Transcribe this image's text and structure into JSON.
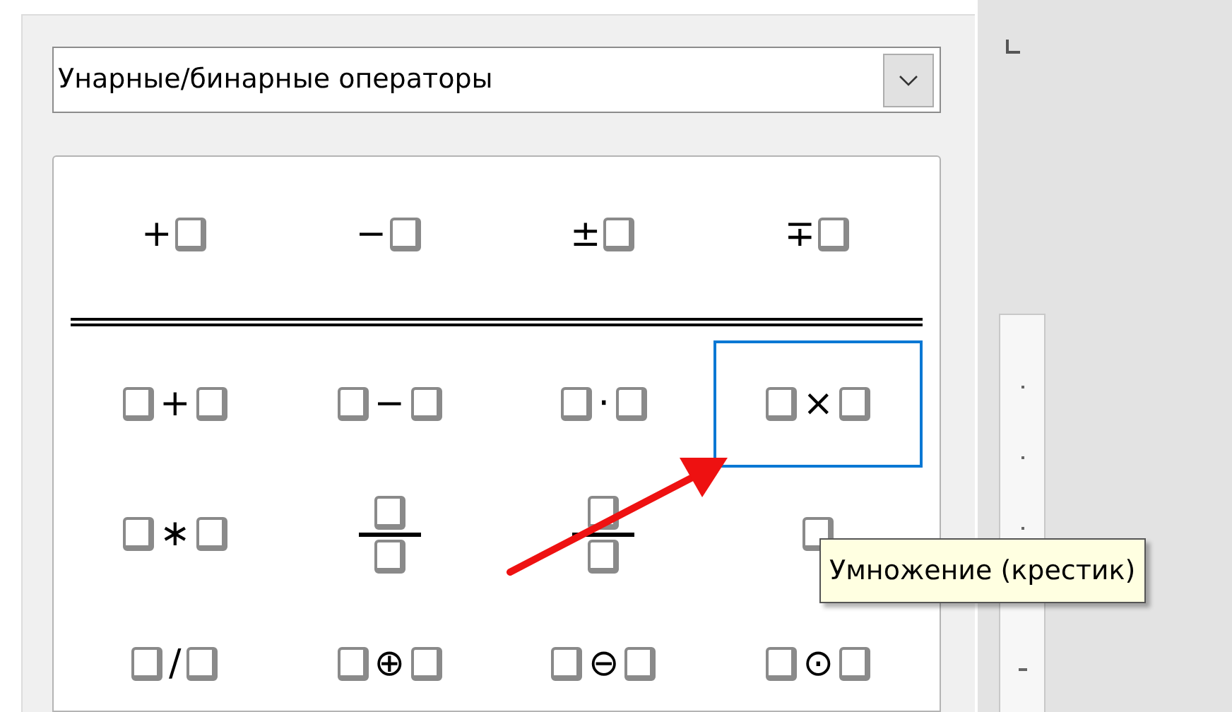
{
  "category_dropdown": {
    "value": "Унарные/бинарные операторы"
  },
  "groups": [
    {
      "kind": "unary",
      "cells": [
        {
          "kind": "unary",
          "operator": "+",
          "selected": false
        },
        {
          "kind": "unary",
          "operator": "−",
          "selected": false
        },
        {
          "kind": "unary",
          "operator": "±",
          "selected": false
        },
        {
          "kind": "unary",
          "operator": "∓",
          "selected": false
        }
      ]
    },
    {
      "kind": "binary",
      "cells": [
        {
          "kind": "binary",
          "operator": "+",
          "selected": false
        },
        {
          "kind": "binary",
          "operator": "−",
          "selected": false
        },
        {
          "kind": "binary",
          "operator": "·",
          "selected": false
        },
        {
          "kind": "binary",
          "operator": "×",
          "selected": true
        },
        {
          "kind": "binary",
          "operator": "∗",
          "selected": false
        },
        {
          "kind": "fraction",
          "selected": false
        },
        {
          "kind": "fraction",
          "selected": false
        },
        {
          "kind": "binary",
          "selected": false
        },
        {
          "kind": "binary",
          "operator": "/",
          "selected": false
        },
        {
          "kind": "binary",
          "operator": "⊕",
          "selected": false
        },
        {
          "kind": "binary",
          "operator": "⊖",
          "selected": false
        },
        {
          "kind": "binary",
          "operator": "⊙",
          "selected": false
        }
      ]
    }
  ],
  "tooltip": {
    "text": "Умножение (крестик)"
  }
}
